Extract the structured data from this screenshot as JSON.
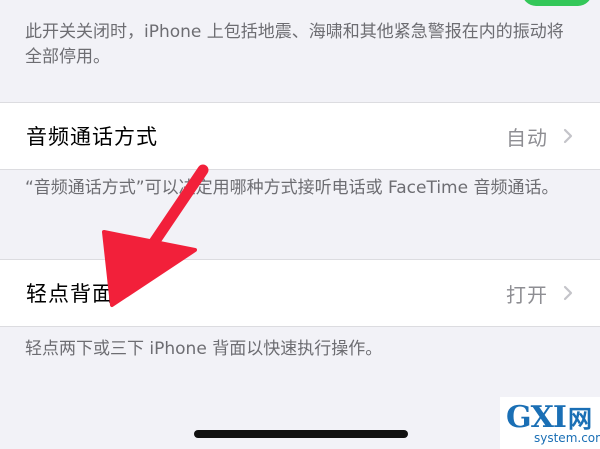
{
  "emergency_alerts": {
    "footnote": "此开关关闭时，iPhone 上包括地震、海啸和其他紧急警报在内的振动将全部停用。"
  },
  "audio_call_routing": {
    "label": "音频通话方式",
    "value": "自动",
    "footnote": "“音频通话方式”可以决定用哪种方式接听电话或 FaceTime 音频通话。"
  },
  "back_tap": {
    "label": "轻点背面",
    "value": "打开",
    "footnote": "轻点两下或三下 iPhone 背面以快速执行操作。"
  },
  "watermark": {
    "main_text": "GXI",
    "cn_text": "网",
    "sub_text": "system.com"
  },
  "colors": {
    "background": "#f2f2f7",
    "cell_background": "#ffffff",
    "toggle_on": "#34c759",
    "annotation_arrow": "#f2203a",
    "watermark": "#1a6fb5"
  },
  "icons": {
    "chevron": "chevron-right-icon",
    "annotation": "red-arrow-annotation"
  }
}
